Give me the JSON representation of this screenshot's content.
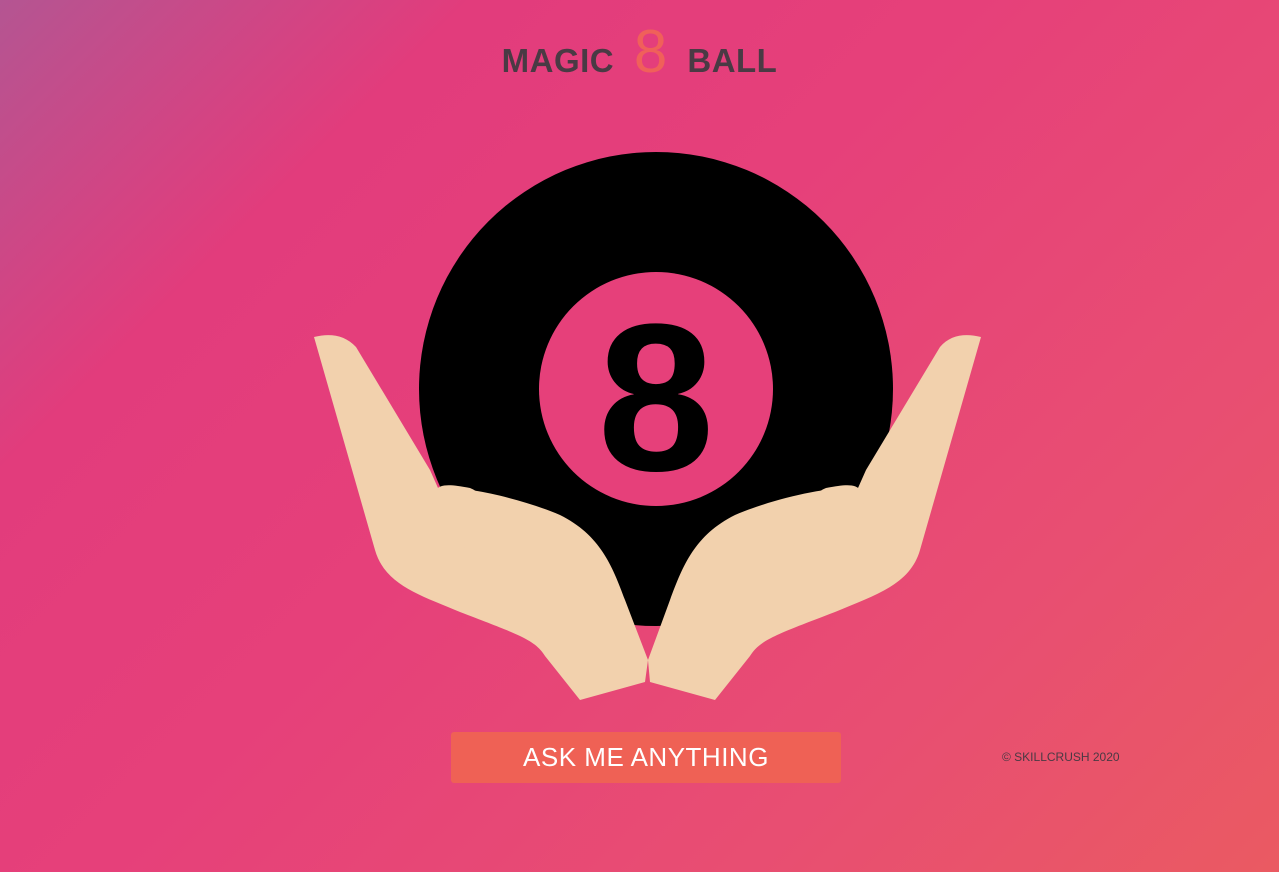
{
  "header": {
    "title_left": "MAGIC",
    "title_number": "8",
    "title_right": "BALL"
  },
  "illustration": {
    "ball_icon": "eight-ball-icon",
    "ball_number": "8",
    "hands_icon": "cupped-hands-icon"
  },
  "actions": {
    "ask_label": "ASK ME ANYTHING"
  },
  "footer": {
    "copyright": "© SKILLCRUSH 2020"
  },
  "colors": {
    "accent": "#f0605a",
    "button": "#ef6155",
    "title_text": "#4a3a44",
    "ball": "#000000",
    "ball_window": "#e6407a",
    "skin": "#f2d1ad"
  }
}
